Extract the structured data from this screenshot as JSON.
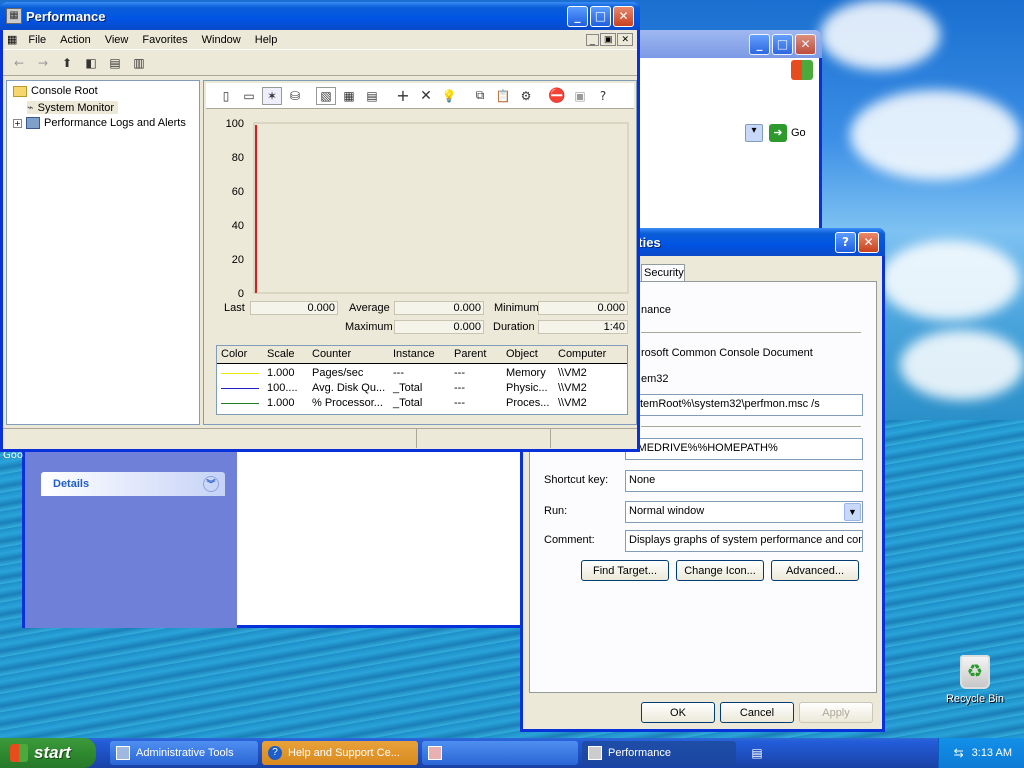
{
  "taskbar": {
    "start_label": "start",
    "tasks": [
      {
        "label": "Administrative Tools"
      },
      {
        "label": "Help and Support Ce..."
      },
      {
        "label": ""
      },
      {
        "label": "Performance"
      }
    ],
    "clock": "3:13 AM"
  },
  "desktop": {
    "recycle_bin_label": "Recycle Bin"
  },
  "background_window": {
    "go_label": "Go",
    "details_label": "Details",
    "left_edge_text": "Goo"
  },
  "properties": {
    "title_fragment": "erties",
    "tab_security": "Security",
    "name_fragment": "nance",
    "type_fragment": "rosoft Common Console Document",
    "location_fragment": "em32",
    "target_value": "ystemRoot%\\system32\\perfmon.msc /s",
    "start_in_value": "OMEDRIVE%%HOMEPATH%",
    "shortcut_label": "Shortcut key:",
    "shortcut_value": "None",
    "run_label": "Run:",
    "run_value": "Normal window",
    "comment_label": "Comment:",
    "comment_value": "Displays graphs of system performance and config",
    "find_target": "Find Target...",
    "change_icon": "Change Icon...",
    "advanced": "Advanced...",
    "ok": "OK",
    "cancel": "Cancel",
    "apply": "Apply"
  },
  "perf": {
    "title": "Performance",
    "menu": [
      "File",
      "Action",
      "View",
      "Favorites",
      "Window",
      "Help"
    ],
    "tree": {
      "root": "Console Root",
      "monitor": "System Monitor",
      "logs": "Performance Logs and Alerts"
    },
    "stats": {
      "last_label": "Last",
      "last_value": "0.000",
      "average_label": "Average",
      "average_value": "0.000",
      "minimum_label": "Minimum",
      "minimum_value": "0.000",
      "maximum_label": "Maximum",
      "maximum_value": "0.000",
      "duration_label": "Duration",
      "duration_value": "1:40"
    },
    "columns": [
      "Color",
      "Scale",
      "Counter",
      "Instance",
      "Parent",
      "Object",
      "Computer"
    ],
    "rows": [
      {
        "color": "#e8e800",
        "scale": "1.000",
        "counter": "Pages/sec",
        "instance": "---",
        "parent": "---",
        "object": "Memory",
        "computer": "\\\\VM2"
      },
      {
        "color": "#2020c8",
        "scale": "100....",
        "counter": "Avg. Disk Qu...",
        "instance": "_Total",
        "parent": "---",
        "object": "Physic...",
        "computer": "\\\\VM2"
      },
      {
        "color": "#208020",
        "scale": "1.000",
        "counter": "% Processor...",
        "instance": "_Total",
        "parent": "---",
        "object": "Proces...",
        "computer": "\\\\VM2"
      }
    ]
  },
  "chart_data": {
    "type": "line",
    "title": "",
    "xlabel": "",
    "ylabel": "",
    "ylim": [
      0,
      100
    ],
    "y_ticks": [
      "100",
      "80",
      "60",
      "40",
      "20",
      "0"
    ],
    "grid": false,
    "marker_line_color": "#d81e1e",
    "series": []
  }
}
